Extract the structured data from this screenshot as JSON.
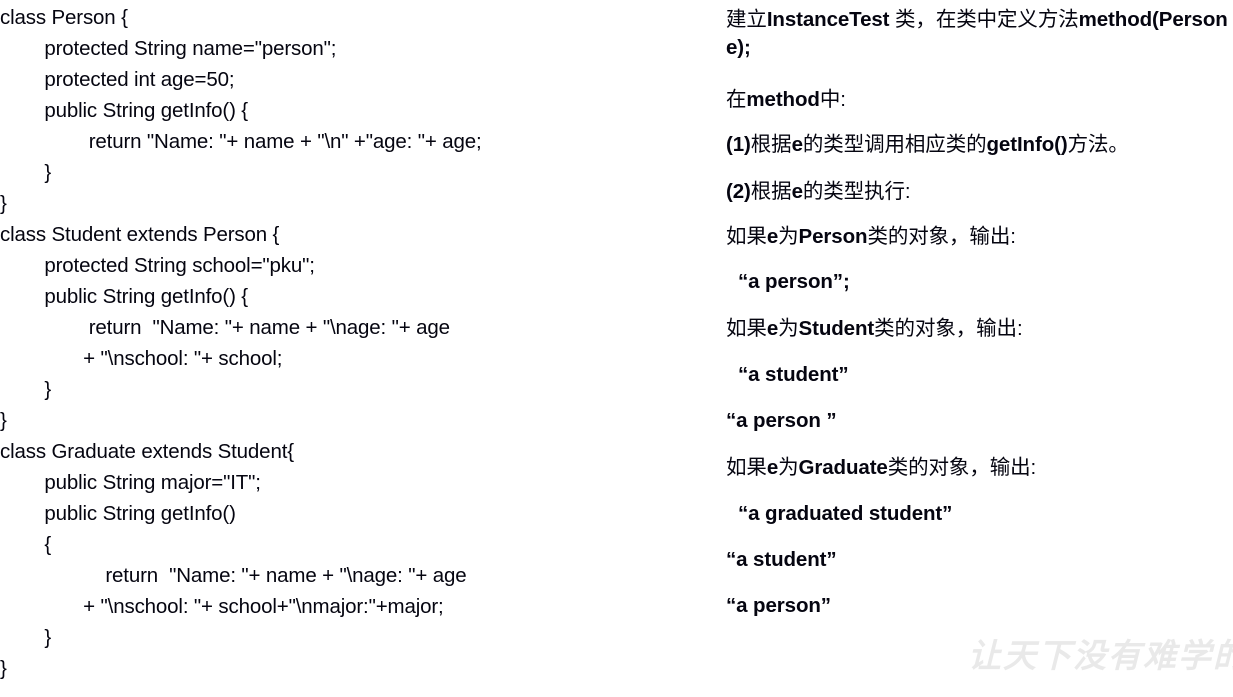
{
  "slide": {
    "title_text": "",
    "background_color": "#ffffff",
    "text_color": "#050510",
    "watermark_color": "#e9e9e9"
  },
  "code_panel": {
    "language": "java",
    "lines": [
      "class Person {",
      "        protected String name=\"person\";",
      "        protected int age=50;",
      "        public String getInfo() {",
      "                return \"Name: \"+ name + \"\\n\" +\"age: \"+ age;",
      "        }",
      "}",
      "class Student extends Person {",
      "        protected String school=\"pku\";",
      "        public String getInfo() {",
      "                return  \"Name: \"+ name + \"\\nage: \"+ age",
      "               + \"\\nschool: \"+ school;",
      "        }",
      "}",
      "class Graduate extends Student{",
      "        public String major=\"IT\";",
      "        public String getInfo()",
      "        {",
      "                   return  \"Name: \"+ name + \"\\nage: \"+ age",
      "               + \"\\nschool: \"+ school+\"\\nmajor:\"+major;",
      "        }",
      "}"
    ]
  },
  "spec_panel": {
    "lines": [
      {
        "id": "task-intro",
        "segments": [
          {
            "text": "建立",
            "script": "cjk"
          },
          {
            "text": "InstanceTest ",
            "script": "latin"
          },
          {
            "text": "类，在类中定义方法",
            "script": "cjk"
          },
          {
            "text": "method(Person e);",
            "script": "latin"
          }
        ]
      },
      {
        "id": "in-method",
        "segments": [
          {
            "text": "在",
            "script": "cjk"
          },
          {
            "text": "method",
            "script": "latin"
          },
          {
            "text": "中:",
            "script": "cjk"
          }
        ]
      },
      {
        "id": "rule-1",
        "segments": [
          {
            "text": "(1)",
            "script": "latin"
          },
          {
            "text": "根据",
            "script": "cjk"
          },
          {
            "text": "e",
            "script": "latin"
          },
          {
            "text": "的类型调用相应类的",
            "script": "cjk"
          },
          {
            "text": "getInfo()",
            "script": "latin"
          },
          {
            "text": "方法。",
            "script": "cjk"
          }
        ]
      },
      {
        "id": "rule-2",
        "segments": [
          {
            "text": "(2)",
            "script": "latin"
          },
          {
            "text": "根据",
            "script": "cjk"
          },
          {
            "text": "e",
            "script": "latin"
          },
          {
            "text": "的类型执行:",
            "script": "cjk"
          }
        ]
      },
      {
        "id": "case-person",
        "segments": [
          {
            "text": "如果",
            "script": "cjk"
          },
          {
            "text": "e",
            "script": "latin"
          },
          {
            "text": "为",
            "script": "cjk"
          },
          {
            "text": "Person",
            "script": "latin"
          },
          {
            "text": "类的对象，输出:",
            "script": "cjk"
          }
        ]
      },
      {
        "id": "out-person-1",
        "indented": true,
        "segments": [
          {
            "text": "“a person”;",
            "script": "latin"
          }
        ]
      },
      {
        "id": "case-student",
        "segments": [
          {
            "text": "如果",
            "script": "cjk"
          },
          {
            "text": "e",
            "script": "latin"
          },
          {
            "text": "为",
            "script": "cjk"
          },
          {
            "text": "Student",
            "script": "latin"
          },
          {
            "text": "类的对象，输出:",
            "script": "cjk"
          }
        ]
      },
      {
        "id": "out-student-1",
        "indented": true,
        "segments": [
          {
            "text": "“a student”",
            "script": "latin"
          }
        ]
      },
      {
        "id": "out-student-person",
        "segments": [
          {
            "text": "“a person ”",
            "script": "latin"
          }
        ]
      },
      {
        "id": "case-graduate",
        "segments": [
          {
            "text": "如果",
            "script": "cjk"
          },
          {
            "text": "e",
            "script": "latin"
          },
          {
            "text": "为",
            "script": "cjk"
          },
          {
            "text": "Graduate",
            "script": "latin"
          },
          {
            "text": "类的对象，输出:",
            "script": "cjk"
          }
        ]
      },
      {
        "id": "out-graduate-1",
        "indented": true,
        "segments": [
          {
            "text": "“a graduated student”",
            "script": "latin"
          }
        ]
      },
      {
        "id": "out-graduate-student",
        "segments": [
          {
            "text": "“a student”",
            "script": "latin"
          }
        ]
      },
      {
        "id": "out-graduate-person",
        "segments": [
          {
            "text": "“a person”",
            "script": "latin"
          }
        ]
      }
    ]
  },
  "watermark": {
    "text": "让天下没有难学的技"
  }
}
